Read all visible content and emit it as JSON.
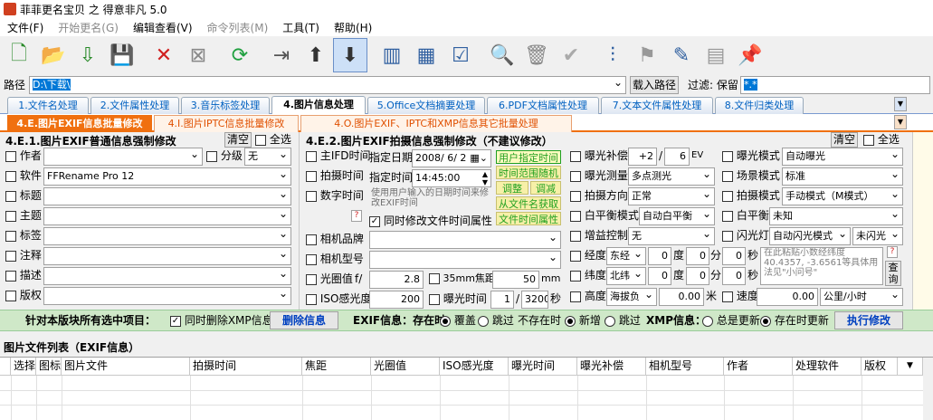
{
  "window": {
    "title": "菲菲更名宝贝 之 得意非凡 5.0"
  },
  "menu": [
    "文件(F)",
    "开始更名(G)",
    "编辑查看(V)",
    "命令列表(M)",
    "工具(T)",
    "帮助(H)"
  ],
  "toolbar": {
    "icons": [
      "new-file-icon",
      "open-folder-icon",
      "import-icon",
      "save-icon",
      "delete-icon",
      "clear-icon",
      "refresh-icon",
      "move-icon",
      "up-icon",
      "down-icon",
      "grid1-icon",
      "grid2-icon",
      "checklist-icon",
      "search-icon",
      "trash-icon",
      "ok-icon",
      "sliders-icon",
      "flag-icon",
      "edit-icon",
      "table-icon",
      "pin-icon"
    ]
  },
  "pathbar": {
    "label": "路径",
    "value": "D:\\下载\\",
    "load_btn": "载入路径",
    "filter_label": "过滤: 保留",
    "filter_value": "*.*"
  },
  "tabs1": [
    "1.文件名处理",
    "2.文件属性处理",
    "3.音乐标签处理",
    "4.图片信息处理",
    "5.Office文档摘要处理",
    "6.PDF文档属性处理",
    "7.文本文件属性处理",
    "8.文件归类处理"
  ],
  "tabs2": [
    "4.E.图片EXIF信息批量修改",
    "4.I.图片IPTC信息批量修改",
    "4.O.图片EXIF、IPTC和XMP信息其它批量处理"
  ],
  "left": {
    "title": "4.E.1.图片EXIF普通信息强制修改",
    "clear": "清空",
    "selectall": "全选",
    "author": "作者",
    "rating": "分级",
    "rating_val": "无",
    "software": "软件",
    "software_val": "FFRename Pro 12",
    "fields": [
      "标题",
      "主题",
      "标签",
      "注释",
      "描述",
      "版权"
    ]
  },
  "mid": {
    "title": "4.E.2.图片EXIF拍摄信息强制修改（不建议修改）",
    "ifd": "主IFD时间",
    "capture": "拍摄时间",
    "digital": "数字时间",
    "date_lbl": "指定日期",
    "date_val": "2008/ 6/ 2",
    "time_lbl": "指定时间",
    "time_val": "14:45:00",
    "hint": "使用用户输入的日期时间来修改EXIF时间",
    "q": "?",
    "sync": "同时修改文件时间属性",
    "g1": "用户指定时间",
    "g2": "时间范围随机",
    "g3": "调整",
    "g4": "调减",
    "g5": "从文件名获取",
    "g6": "文件时间属性",
    "make": "相机品牌",
    "model": "相机型号",
    "aperture": "光圈值",
    "f": "f/",
    "aperture_val": "2.8",
    "focal35": "35mm焦距",
    "focal_val": "50",
    "mm": "mm",
    "iso": "ISO感光度",
    "iso_val": "200",
    "exposure": "曝光时间",
    "exp1": "1",
    "exp2": "3200",
    "sec": "秒"
  },
  "right": {
    "clear": "清空",
    "selectall": "全选",
    "ev_lbl": "曝光补偿",
    "ev_val": "+2",
    "ev_sep": "/",
    "ev_val2": "6",
    "ev": "EV",
    "meter": "曝光测量",
    "meter_val": "多点测光",
    "dir": "拍摄方向",
    "dir_val": "正常",
    "wb": "白平衡模式",
    "wb_val": "自动白平衡",
    "gain": "增益控制",
    "gain_val": "无",
    "lon": "经度",
    "lon_dir": "东经",
    "deg": "度",
    "min": "分",
    "sec": "秒",
    "v0": "0",
    "lat": "纬度",
    "lat_dir": "北纬",
    "alt": "高度",
    "alt_ref": "海拔负",
    "alt_val": "0.00",
    "m": "米",
    "paste_hint": "在此粘贴小数经纬度40.4357, -3.6561等具体用法见\"小问号\"",
    "query": "查询",
    "mode": "曝光模式",
    "mode_val": "自动曝光",
    "scene": "场景模式",
    "scene_val": "标准",
    "shoot": "拍摄模式",
    "shoot_val": "手动模式（M模式）",
    "wb2": "白平衡",
    "wb2_val": "未知",
    "flash": "闪光灯",
    "flash_val": "自动闪光模式",
    "flash_val2": "未闪光",
    "speed": "速度",
    "speed_val": "0.00",
    "speed_unit": "公里/小时"
  },
  "actionbar": {
    "label": "针对本版块所有选中项目：",
    "xmpdel": "同时删除XMP信息",
    "delbtn": "删除信息",
    "exif_lbl": "EXIF信息：存在时",
    "cover": "覆盖",
    "skip": "跳过",
    "notexist": "不存在时",
    "add": "新增",
    "skip2": "跳过",
    "xmp_lbl": "XMP信息：",
    "always": "总是更新",
    "exist": "存在时更新",
    "exec": "执行修改"
  },
  "list": {
    "title": "图片文件列表（EXIF信息）",
    "cols": [
      "选择",
      "图标",
      "图片文件",
      "拍摄时间",
      "焦距",
      "光圈值",
      "ISO感光度",
      "曝光时间",
      "曝光补偿",
      "相机型号",
      "作者",
      "处理软件",
      "版权"
    ]
  }
}
